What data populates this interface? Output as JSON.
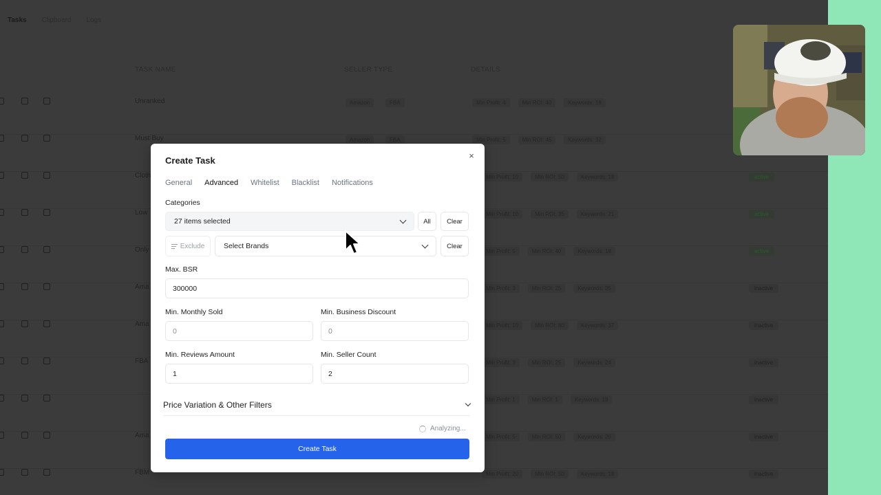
{
  "background": {
    "top_tabs": [
      "Tasks",
      "Clipboard",
      "Logs"
    ],
    "columns": [
      "TASK NAME",
      "SELLER TYPE",
      "DETAILS"
    ],
    "rows": [
      {
        "name": "Unranked",
        "seller": [
          "Amazon",
          "FBA"
        ],
        "details": [
          "Min Profit: 4",
          "Min ROI: 40",
          "Keywords: 18"
        ],
        "status": ""
      },
      {
        "name": "Must Buy",
        "seller": [
          "Amazon",
          "FBA"
        ],
        "details": [
          "Min Profit: 5",
          "Min ROI: 45",
          "Keywords: 32"
        ],
        "status": ""
      },
      {
        "name": "Cloth",
        "seller": [],
        "details": [
          "Min Profit: 10",
          "Min ROI: 50",
          "Keywords: 18"
        ],
        "status": "active"
      },
      {
        "name": "Low",
        "seller": [],
        "details": [
          "Min Profit: 10",
          "Min ROI: 35",
          "Keywords: 21"
        ],
        "status": "active"
      },
      {
        "name": "Only",
        "seller": [],
        "details": [
          "Min Profit: 5",
          "Min ROI: 40",
          "Keywords: 18"
        ],
        "status": "active"
      },
      {
        "name": "Ama",
        "seller": [],
        "details": [
          "Min Profit: 3",
          "Min ROI: 25",
          "Keywords: 35"
        ],
        "status": "inactive"
      },
      {
        "name": "Ama",
        "seller": [],
        "details": [
          "Min Profit: 10",
          "Min ROI: 80",
          "Keywords: 37"
        ],
        "status": "inactive"
      },
      {
        "name": "FBA",
        "seller": [],
        "details": [
          "Min Profit: 3",
          "Min ROI: 25",
          "Keywords: 24"
        ],
        "status": "inactive"
      },
      {
        "name": "",
        "seller": [],
        "details": [
          "Min Profit: 1",
          "Min ROI: 1",
          "Keywords: 18"
        ],
        "status": "inactive"
      },
      {
        "name": "Ama",
        "seller": [],
        "details": [
          "Min Profit: 5",
          "Min ROI: 50",
          "Keywords: 20"
        ],
        "status": "inactive"
      },
      {
        "name": "FBM",
        "seller": [],
        "details": [
          "Min Profit: 20",
          "Min ROI: 50",
          "Keywords: 18"
        ],
        "status": "inactive"
      }
    ]
  },
  "modal": {
    "title": "Create Task",
    "close": "×",
    "tabs": [
      "General",
      "Advanced",
      "Whitelist",
      "Blacklist",
      "Notifications"
    ],
    "active_tab": "Advanced",
    "categories_label": "Categories",
    "categories_value": "27 items selected",
    "all_label": "All",
    "clear_label": "Clear",
    "exclude_label": "Exclude",
    "brands_placeholder": "Select Brands",
    "brands_clear_label": "Clear",
    "max_bsr_label": "Max. BSR",
    "max_bsr_value": "300000",
    "min_monthly_sold_label": "Min. Monthly Sold",
    "min_monthly_sold_value": "0",
    "min_business_discount_label": "Min. Business Discount",
    "min_business_discount_value": "0",
    "min_reviews_label": "Min. Reviews Amount",
    "min_reviews_value": "1",
    "min_seller_count_label": "Min. Seller Count",
    "min_seller_count_value": "2",
    "price_variation_label": "Price Variation & Other Filters",
    "analyzing_label": "Analyzing...",
    "submit_label": "Create Task"
  },
  "colors": {
    "primary": "#2563eb",
    "side_strip": "#8fe7b8"
  }
}
